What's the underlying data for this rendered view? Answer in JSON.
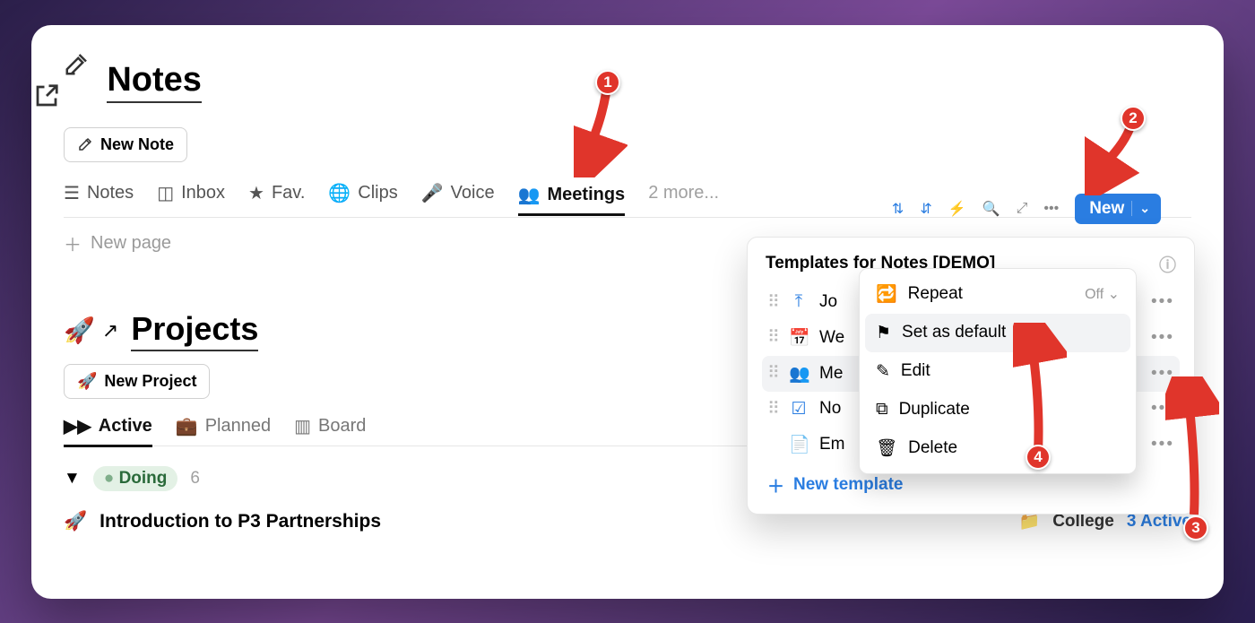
{
  "notes": {
    "title": "Notes",
    "new_button": "New Note",
    "tabs": [
      {
        "icon": "list",
        "label": "Notes"
      },
      {
        "icon": "inbox",
        "label": "Inbox"
      },
      {
        "icon": "star",
        "label": "Fav."
      },
      {
        "icon": "globe",
        "label": "Clips"
      },
      {
        "icon": "mic",
        "label": "Voice"
      },
      {
        "icon": "people",
        "label": "Meetings"
      },
      {
        "icon": "",
        "label": "2 more..."
      }
    ],
    "active_tab_index": 5,
    "new_page": "New page",
    "toolbar_new": "New"
  },
  "projects": {
    "title": "Projects",
    "new_button": "New Project",
    "tabs": [
      {
        "icon": "ff",
        "label": "Active"
      },
      {
        "icon": "briefcase",
        "label": "Planned"
      },
      {
        "icon": "board",
        "label": "Board"
      }
    ],
    "active_tab_index": 0,
    "group": {
      "name": "Doing",
      "count": "6"
    },
    "item": {
      "title": "Introduction to P3 Partnerships",
      "folder": "College",
      "meta": "3 Active"
    }
  },
  "popover": {
    "title_prefix": "Templates for ",
    "title_bold": "Notes [DEMO]",
    "rows": [
      {
        "icon": "upload",
        "label": "Jo",
        "color": "#2a7de1"
      },
      {
        "icon": "calendar",
        "label": "We",
        "color": "#2a7de1"
      },
      {
        "icon": "people",
        "label": "Me",
        "color": "#2a7de1",
        "selected": true,
        "default": "T"
      },
      {
        "icon": "checklist",
        "label": "No",
        "color": "#2a7de1"
      },
      {
        "icon": "page",
        "label": "Em",
        "color": "#999"
      }
    ],
    "new_template": "New template"
  },
  "ctx": {
    "items": [
      {
        "icon": "repeat",
        "label": "Repeat",
        "meta": "Off"
      },
      {
        "icon": "flag",
        "label": "Set as default",
        "hl": true
      },
      {
        "icon": "edit",
        "label": "Edit"
      },
      {
        "icon": "dup",
        "label": "Duplicate"
      },
      {
        "icon": "trash",
        "label": "Delete"
      }
    ]
  },
  "annotations": {
    "b1": "1",
    "b2": "2",
    "b3": "3",
    "b4": "4"
  }
}
